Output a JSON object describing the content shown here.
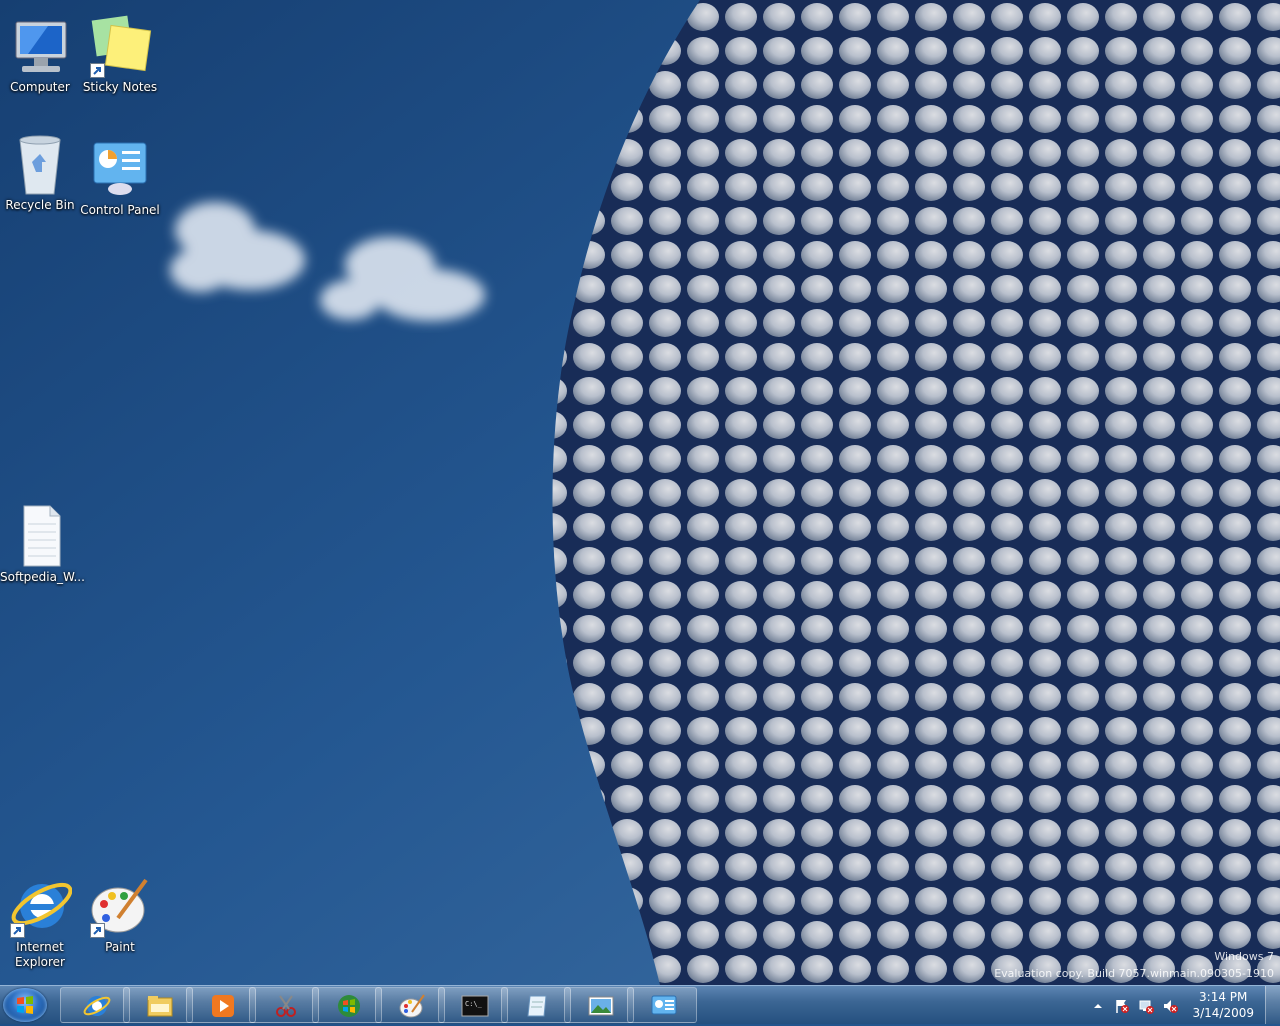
{
  "desktop": {
    "icons": [
      {
        "label": "Computer",
        "icon": "computer-icon"
      },
      {
        "label": "Sticky Notes",
        "icon": "sticky-notes-icon"
      },
      {
        "label": "Recycle Bin",
        "icon": "recycle-bin-icon"
      },
      {
        "label": "Control Panel",
        "icon": "control-panel-icon"
      },
      {
        "label": "Softpedia_W...",
        "icon": "text-document-icon"
      },
      {
        "label": "Internet Explorer",
        "icon": "internet-explorer-icon"
      },
      {
        "label": "Paint",
        "icon": "paint-icon"
      }
    ],
    "watermark": {
      "line1": "Windows 7",
      "line2": "Evaluation copy. Build 7057.winmain.090305-1910"
    }
  },
  "taskbar": {
    "pinned": [
      {
        "name": "internet-explorer",
        "icon": "internet-explorer-icon"
      },
      {
        "name": "windows-explorer",
        "icon": "folder-icon"
      },
      {
        "name": "media-player",
        "icon": "media-player-icon"
      },
      {
        "name": "snipping-tool",
        "icon": "scissors-icon"
      },
      {
        "name": "windows-logo-app",
        "icon": "windows-logo-icon"
      },
      {
        "name": "paint",
        "icon": "paint-icon"
      },
      {
        "name": "command-prompt",
        "icon": "command-prompt-icon"
      },
      {
        "name": "journal",
        "icon": "notepad-icon"
      },
      {
        "name": "photo-viewer",
        "icon": "picture-icon"
      },
      {
        "name": "control-panel",
        "icon": "control-panel-icon"
      }
    ],
    "clock": {
      "time": "3:14 PM",
      "date": "3/14/2009"
    }
  },
  "colors": {
    "sky": "#24578f",
    "taskbar": "#3c6694"
  }
}
